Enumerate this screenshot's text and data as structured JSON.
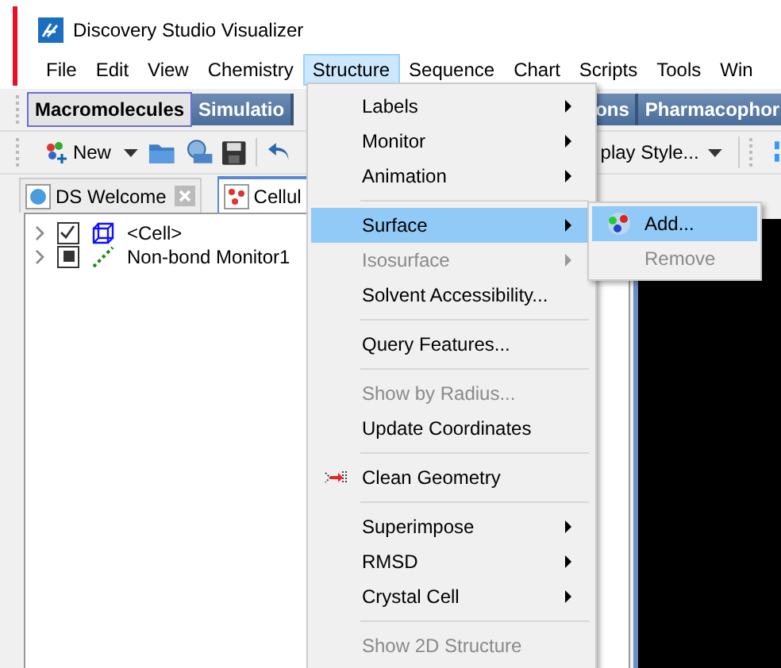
{
  "window": {
    "title": "Discovery Studio Visualizer"
  },
  "menubar": [
    {
      "label": "File",
      "selected": false
    },
    {
      "label": "Edit",
      "selected": false
    },
    {
      "label": "View",
      "selected": false
    },
    {
      "label": "Chemistry",
      "selected": false
    },
    {
      "label": "Structure",
      "selected": true
    },
    {
      "label": "Sequence",
      "selected": false
    },
    {
      "label": "Chart",
      "selected": false
    },
    {
      "label": "Scripts",
      "selected": false
    },
    {
      "label": "Tools",
      "selected": false
    },
    {
      "label": "Win",
      "selected": false
    }
  ],
  "toolbar_tabs": [
    {
      "label": "Macromolecules",
      "selected": true
    },
    {
      "label": "Simulatio",
      "selected": false
    },
    {
      "label": "ons",
      "selected": false
    },
    {
      "label": "Pharmacophor",
      "selected": false
    }
  ],
  "toolbar": {
    "new_button": "New",
    "display_style": "play Style..."
  },
  "document_tabs": [
    {
      "label": "DS Welcome",
      "selected": false,
      "closable": true
    },
    {
      "label": "Cellul",
      "selected": true,
      "closable": false
    }
  ],
  "tree": [
    {
      "label": "<Cell>",
      "kind": "cell",
      "checked": true,
      "mixed": false
    },
    {
      "label": "Non-bond Monitor1",
      "kind": "monitor",
      "checked": false,
      "mixed": true
    }
  ],
  "menu": {
    "items": [
      {
        "kind": "item",
        "label": "Labels",
        "submenu": true,
        "disabled": false,
        "selected": false,
        "has_icon": false
      },
      {
        "kind": "item",
        "label": "Monitor",
        "submenu": true,
        "disabled": false,
        "selected": false,
        "has_icon": false
      },
      {
        "kind": "item",
        "label": "Animation",
        "submenu": true,
        "disabled": false,
        "selected": false,
        "has_icon": false
      },
      {
        "kind": "separator"
      },
      {
        "kind": "item",
        "label": "Surface",
        "submenu": true,
        "disabled": false,
        "selected": true,
        "has_icon": false
      },
      {
        "kind": "item",
        "label": "Isosurface",
        "submenu": true,
        "disabled": true,
        "selected": false,
        "has_icon": false
      },
      {
        "kind": "item",
        "label": "Solvent Accessibility...",
        "submenu": false,
        "disabled": false,
        "selected": false,
        "has_icon": false
      },
      {
        "kind": "separator"
      },
      {
        "kind": "item",
        "label": "Query Features...",
        "submenu": false,
        "disabled": false,
        "selected": false,
        "has_icon": false
      },
      {
        "kind": "separator"
      },
      {
        "kind": "item",
        "label": "Show by Radius...",
        "submenu": false,
        "disabled": true,
        "selected": false,
        "has_icon": false
      },
      {
        "kind": "item",
        "label": "Update Coordinates",
        "submenu": false,
        "disabled": false,
        "selected": false,
        "has_icon": false
      },
      {
        "kind": "separator"
      },
      {
        "kind": "item",
        "label": "Clean Geometry",
        "submenu": false,
        "disabled": false,
        "selected": false,
        "has_icon": true
      },
      {
        "kind": "separator"
      },
      {
        "kind": "item",
        "label": "Superimpose",
        "submenu": true,
        "disabled": false,
        "selected": false,
        "has_icon": false
      },
      {
        "kind": "item",
        "label": "RMSD",
        "submenu": true,
        "disabled": false,
        "selected": false,
        "has_icon": false
      },
      {
        "kind": "item",
        "label": "Crystal Cell",
        "submenu": true,
        "disabled": false,
        "selected": false,
        "has_icon": false
      },
      {
        "kind": "separator"
      },
      {
        "kind": "item",
        "label": "Show 2D Structure",
        "submenu": false,
        "disabled": true,
        "selected": false,
        "has_icon": false
      }
    ]
  },
  "submenu": {
    "items": [
      {
        "label": "Add...",
        "selected": true,
        "disabled": false,
        "has_icon": true
      },
      {
        "label": "Remove",
        "selected": false,
        "disabled": true,
        "has_icon": false
      }
    ]
  }
}
